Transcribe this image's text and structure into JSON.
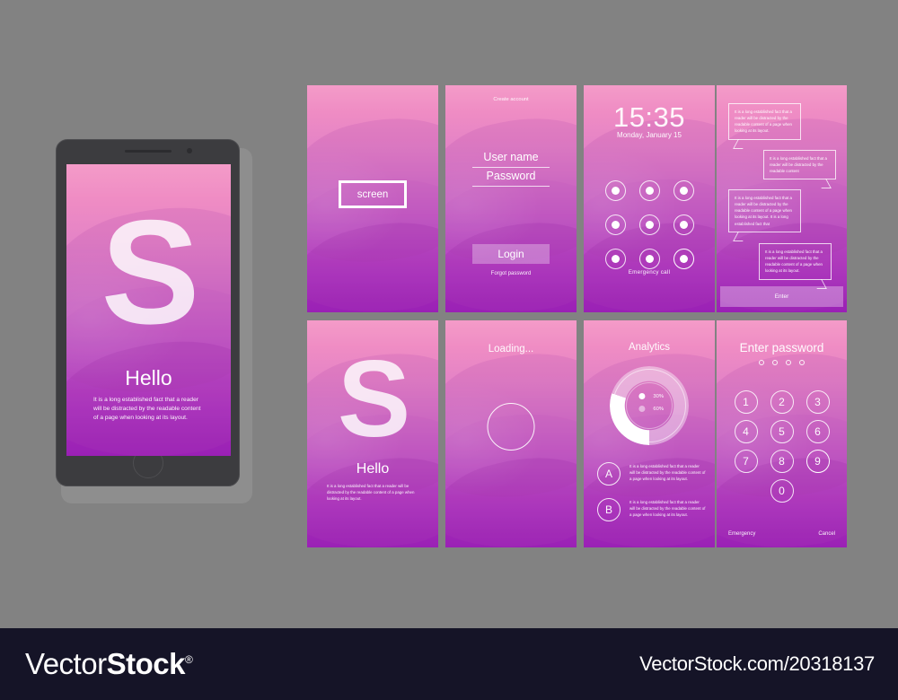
{
  "background_color": "#828282",
  "accent_gradient": {
    "top": "#f49bc8",
    "bottom": "#9d22ba"
  },
  "lorem": {
    "full": "It is a long established fact that a reader will be distracted by the readable content of a page when looking at its layout.",
    "short": "It is a long established fact that a reader will be distracted by the readable content",
    "long": "It is a long established fact that a reader will be distracted by the readable content of a page when looking at its layout. It is a long established fact that"
  },
  "phone": {
    "logo_letter": "S",
    "title": "Hello",
    "body": "It is a long established fact that a reader will be distracted by the readable content of a page when looking at its layout."
  },
  "screens": {
    "screen_placeholder": {
      "label": "screen"
    },
    "login": {
      "create_account": "Create account",
      "username_value": "User name",
      "password_value": "Password",
      "login_label": "Login",
      "forgot_label": "Forgot password"
    },
    "lock_pattern": {
      "time": "15:35",
      "date": "Monday, January 15",
      "emergency_label": "Emergency  call",
      "dots": [
        {
          "active": false
        },
        {
          "active": false
        },
        {
          "active": false
        },
        {
          "active": false
        },
        {
          "active": false
        },
        {
          "active": false
        },
        {
          "active": false
        },
        {
          "active": false
        },
        {
          "active": true
        }
      ]
    },
    "chat": {
      "bubbles": [
        {
          "side": "left",
          "text": "It is a long established fact that a reader will be distracted by the readable content of a page when looking at its layout."
        },
        {
          "side": "right",
          "text": "It is a long established fact that a reader will be distracted by the readable content"
        },
        {
          "side": "left",
          "text": "It is a long established fact that a reader will be distracted by the readable content of a page when looking at its layout. It is a long established fact that"
        },
        {
          "side": "right",
          "text": "It is a long established fact that a reader will be distracted by the readable content of a page when looking at its layout."
        }
      ],
      "enter_label": "Enter"
    },
    "splash": {
      "logo_letter": "S",
      "title": "Hello",
      "body": "It is a long established fact that a reader will be distracted by the readable content of a page when looking at its layout."
    },
    "loading": {
      "title": "Loading..."
    },
    "analytics": {
      "title": "Analytics",
      "items": [
        {
          "letter": "A",
          "text": "It is a long established fact that a reader will be distracted by the readable content of a page when looking at its layout."
        },
        {
          "letter": "B",
          "text": "It is a long established fact that a reader will be distracted by the readable content of a page when looking at its layout."
        }
      ]
    },
    "password": {
      "title": "Enter password",
      "dot_count": 4,
      "keys": [
        "1",
        "2",
        "3",
        "4",
        "5",
        "6",
        "7",
        "8",
        "9"
      ],
      "key_zero": "0",
      "emergency_label": "Emergency",
      "cancel_label": "Cancel"
    }
  },
  "chart_data": {
    "type": "pie",
    "title": "Analytics",
    "labels": [
      "30%",
      "60%"
    ],
    "values": [
      30,
      60
    ],
    "colors": [
      "#ffffff",
      "rgba(255,255,255,0.42)"
    ],
    "legend_position": "center",
    "donut": true
  },
  "footer": {
    "logo_light": "Vector",
    "logo_bold": "Stock",
    "registered_mark": "®",
    "url": "VectorStock.com/20318137"
  }
}
